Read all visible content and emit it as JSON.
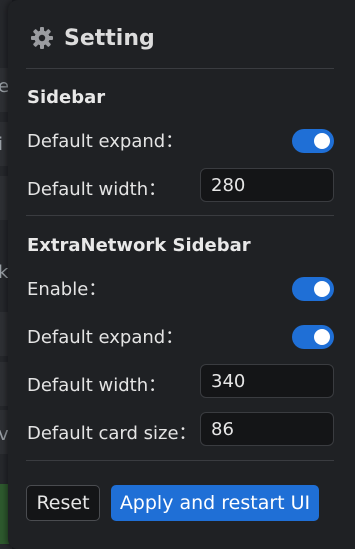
{
  "title": "Setting",
  "background_letters": [
    "e",
    "i",
    "k",
    "v"
  ],
  "sidebar": {
    "heading": "Sidebar",
    "default_expand_label": "Default expand：",
    "default_expand_on": true,
    "default_width_label": "Default width：",
    "default_width_value": "280"
  },
  "extranetwork": {
    "heading": "ExtraNetwork Sidebar",
    "enable_label": "Enable：",
    "enable_on": true,
    "default_expand_label": "Default expand：",
    "default_expand_on": true,
    "default_width_label": "Default width：",
    "default_width_value": "340",
    "card_size_label": "Default card size：",
    "card_size_value": "86"
  },
  "buttons": {
    "reset": "Reset",
    "apply": "Apply and restart UI"
  },
  "colors": {
    "accent": "#1f6fd6",
    "panel": "#1f2124",
    "input_bg": "#141517"
  },
  "icons": {
    "title": "gear-icon"
  }
}
